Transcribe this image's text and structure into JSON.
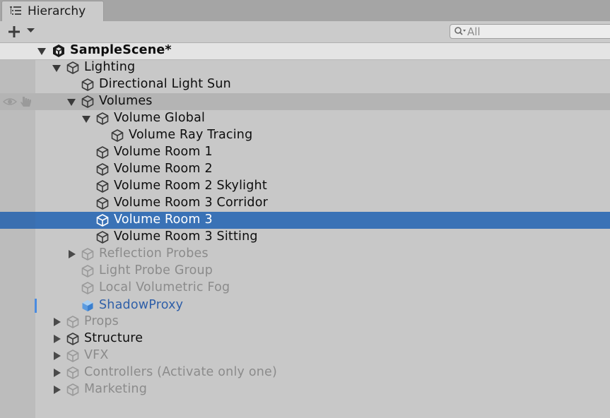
{
  "tab": {
    "label": "Hierarchy",
    "icon": "hierarchy-list-icon"
  },
  "toolbar": {
    "add_icon": "plus-icon",
    "search": {
      "placeholder": "All",
      "value": ""
    }
  },
  "colors": {
    "selection": "#3a72b6",
    "prefab_text": "#2f5fa8",
    "inactive_text": "#8b8b8b",
    "hover_row": "#b4b4b4"
  },
  "scene": {
    "name": "SampleScene*"
  },
  "items": [
    {
      "label": "Lighting",
      "expanded": true,
      "has_children": true,
      "state": "active"
    },
    {
      "label": "Directional Light Sun",
      "state": "active"
    },
    {
      "label": "Volumes",
      "expanded": true,
      "has_children": true,
      "state": "active",
      "hover": true
    },
    {
      "label": "Volume Global",
      "expanded": true,
      "has_children": true,
      "state": "active"
    },
    {
      "label": "Volume Ray Tracing",
      "state": "active"
    },
    {
      "label": "Volume Room 1",
      "state": "active"
    },
    {
      "label": "Volume Room 2",
      "state": "active"
    },
    {
      "label": "Volume Room 2 Skylight",
      "state": "active"
    },
    {
      "label": "Volume Room 3 Corridor",
      "state": "active"
    },
    {
      "label": "Volume Room 3",
      "state": "selected"
    },
    {
      "label": "Volume Room 3 Sitting",
      "state": "active"
    },
    {
      "label": "Reflection Probes",
      "expanded": false,
      "has_children": true,
      "state": "inactive"
    },
    {
      "label": "Light Probe Group",
      "state": "inactive"
    },
    {
      "label": "Local Volumetric Fog",
      "state": "inactive"
    },
    {
      "label": "ShadowProxy",
      "state": "prefab"
    },
    {
      "label": "Props",
      "expanded": false,
      "has_children": true,
      "state": "inactive"
    },
    {
      "label": "Structure",
      "expanded": false,
      "has_children": true,
      "state": "active"
    },
    {
      "label": "VFX",
      "expanded": false,
      "has_children": true,
      "state": "inactive"
    },
    {
      "label": "Controllers (Activate only one)",
      "expanded": false,
      "has_children": true,
      "state": "inactive"
    },
    {
      "label": "Marketing",
      "expanded": false,
      "has_children": true,
      "state": "inactive"
    }
  ]
}
